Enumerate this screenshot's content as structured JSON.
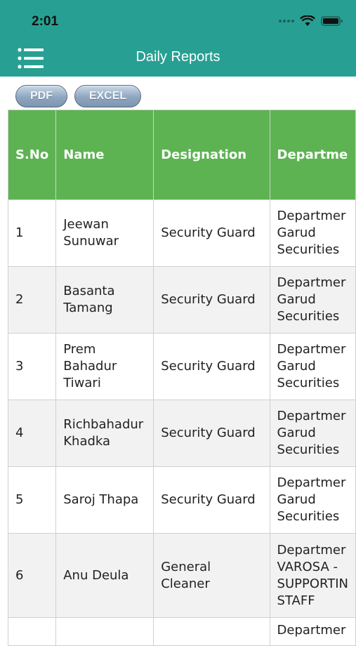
{
  "status_bar": {
    "time": "2:01"
  },
  "header": {
    "title": "Daily Reports"
  },
  "export": {
    "pdf_label": "PDF",
    "excel_label": "EXCEL"
  },
  "colors": {
    "header_bg": "#27a093",
    "table_header_bg": "#5db352"
  },
  "table": {
    "columns": [
      "S.No",
      "Name",
      "Designation",
      "Departme"
    ],
    "rows": [
      {
        "sno": "1",
        "name": "Jeewan Sunuwar",
        "designation": "Security Guard",
        "department": "Departmer\nGarud\nSecurities"
      },
      {
        "sno": "2",
        "name": "Basanta Tamang",
        "designation": "Security Guard",
        "department": "Departmer\nGarud\nSecurities"
      },
      {
        "sno": "3",
        "name": "Prem Bahadur Tiwari",
        "designation": "Security Guard",
        "department": "Departmer\nGarud\nSecurities"
      },
      {
        "sno": "4",
        "name": "Richbahadur Khadka",
        "designation": "Security Guard",
        "department": "Departmer\nGarud\nSecurities"
      },
      {
        "sno": "5",
        "name": "Saroj Thapa",
        "designation": "Security Guard",
        "department": "Departmer\nGarud\nSecurities"
      },
      {
        "sno": "6",
        "name": "Anu Deula",
        "designation": "General Cleaner",
        "department": "Departmer\nVAROSA -\nSUPPORTIN\nSTAFF"
      },
      {
        "sno": "",
        "name": "",
        "designation": "",
        "department": "Departmer"
      }
    ]
  }
}
